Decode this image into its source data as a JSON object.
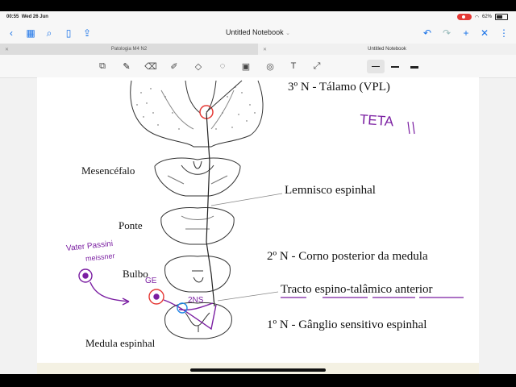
{
  "status": {
    "time": "00:55",
    "date": "Wed 26 Jun",
    "battery": "62%"
  },
  "nav": {
    "title": "Untitled Notebook",
    "title_chevron": "⌄"
  },
  "tabs": [
    {
      "label": "Patologia M4 N2"
    },
    {
      "label": "Untitled Notebook"
    }
  ],
  "colors": {
    "red": "#e53935",
    "blue": "#1e88e5",
    "purple": "#8e24aa",
    "ink_purple": "#7b1fa2"
  },
  "labels": {
    "thalamus": "3º N - Tálamo (VPL)",
    "mesencephalon": "Mesencéfalo",
    "lemniscus": "Lemnisco espinhal",
    "pons": "Ponte",
    "second_neuron": "2º N - Corno posterior da medula",
    "bulbo": "Bulbo",
    "tract": "Tracto espino-talâmico anterior",
    "first_neuron": "1º N - Gânglio sensitivo espinhal",
    "spinal_cord": "Medula espinhal"
  },
  "handwriting": {
    "teta": "TETA",
    "vater": "Vater Passini",
    "vater2": "meissner",
    "ge": "GE",
    "two_ns": "2NS"
  }
}
